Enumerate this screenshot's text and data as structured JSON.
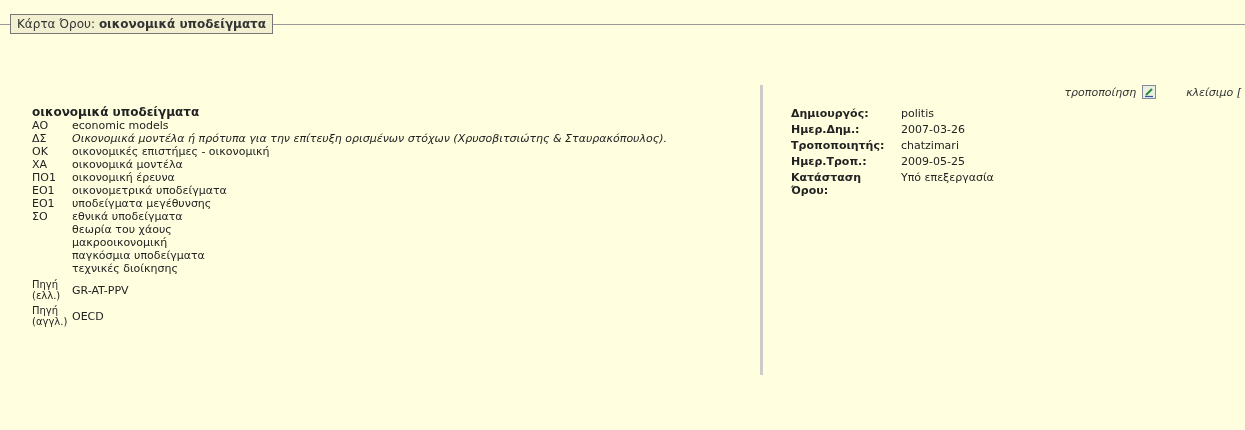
{
  "legend": {
    "prefix": "Κάρτα Όρου:",
    "term": "οικονομικά υποδείγματα"
  },
  "actions": [
    {
      "kind": "edit",
      "label": "τροποποίηση"
    },
    {
      "kind": "close",
      "label": "κλείσιμο ["
    }
  ],
  "term": {
    "heading": "οικονομικά υποδείγματα",
    "entries": [
      {
        "code": "ΑΟ",
        "kind": "plain",
        "values": [
          "economic models"
        ]
      },
      {
        "code": "ΔΣ",
        "kind": "definition",
        "values": [
          "Οικονομικά μοντέλα ή πρότυπα για την επίτευξη ορισμένων στόχων (Χρυσοβιτσιώτης & Σταυρακόπουλος)."
        ]
      },
      {
        "code": "ΟΚ",
        "kind": "plain",
        "values": [
          "οικονομικές επιστήμες - οικονομική"
        ]
      },
      {
        "code": "ΧΑ",
        "kind": "plain",
        "values": [
          "οικονομικά μοντέλα"
        ]
      },
      {
        "code": "ΠΟ1",
        "kind": "plain",
        "values": [
          "οικονομική έρευνα"
        ]
      },
      {
        "code": "ΕΟ1",
        "kind": "plain",
        "values": [
          "οικονομετρικά υποδείγματα"
        ]
      },
      {
        "code": "ΕΟ1",
        "kind": "plain",
        "values": [
          "υποδείγματα μεγέθυνσης"
        ]
      },
      {
        "code": "ΣΟ",
        "kind": "plain",
        "values": [
          "εθνικά υποδείγματα",
          "θεωρία του χάους",
          "μακροοικονομική",
          "παγκόσμια υποδείγματα",
          "τεχνικές διοίκησης"
        ]
      }
    ],
    "sources": [
      {
        "label": "Πηγή",
        "sublabel": "(ελλ.)",
        "value": "GR-AT-PPV"
      },
      {
        "label": "Πηγή",
        "sublabel": "(αγγλ.)",
        "value": "OECD"
      }
    ]
  },
  "meta": [
    {
      "label": "Δημιουργός:",
      "value": "politis"
    },
    {
      "label": "Ημερ.Δημ.:",
      "value": "2007-03-26"
    },
    {
      "label": "Τροποποιητής:",
      "value": "chatzimari"
    },
    {
      "label": "Ημερ.Τροπ.:",
      "value": "2009-05-25"
    },
    {
      "label": "Κατάσταση Όρου:",
      "value": "Υπό επεξεργασία"
    }
  ]
}
